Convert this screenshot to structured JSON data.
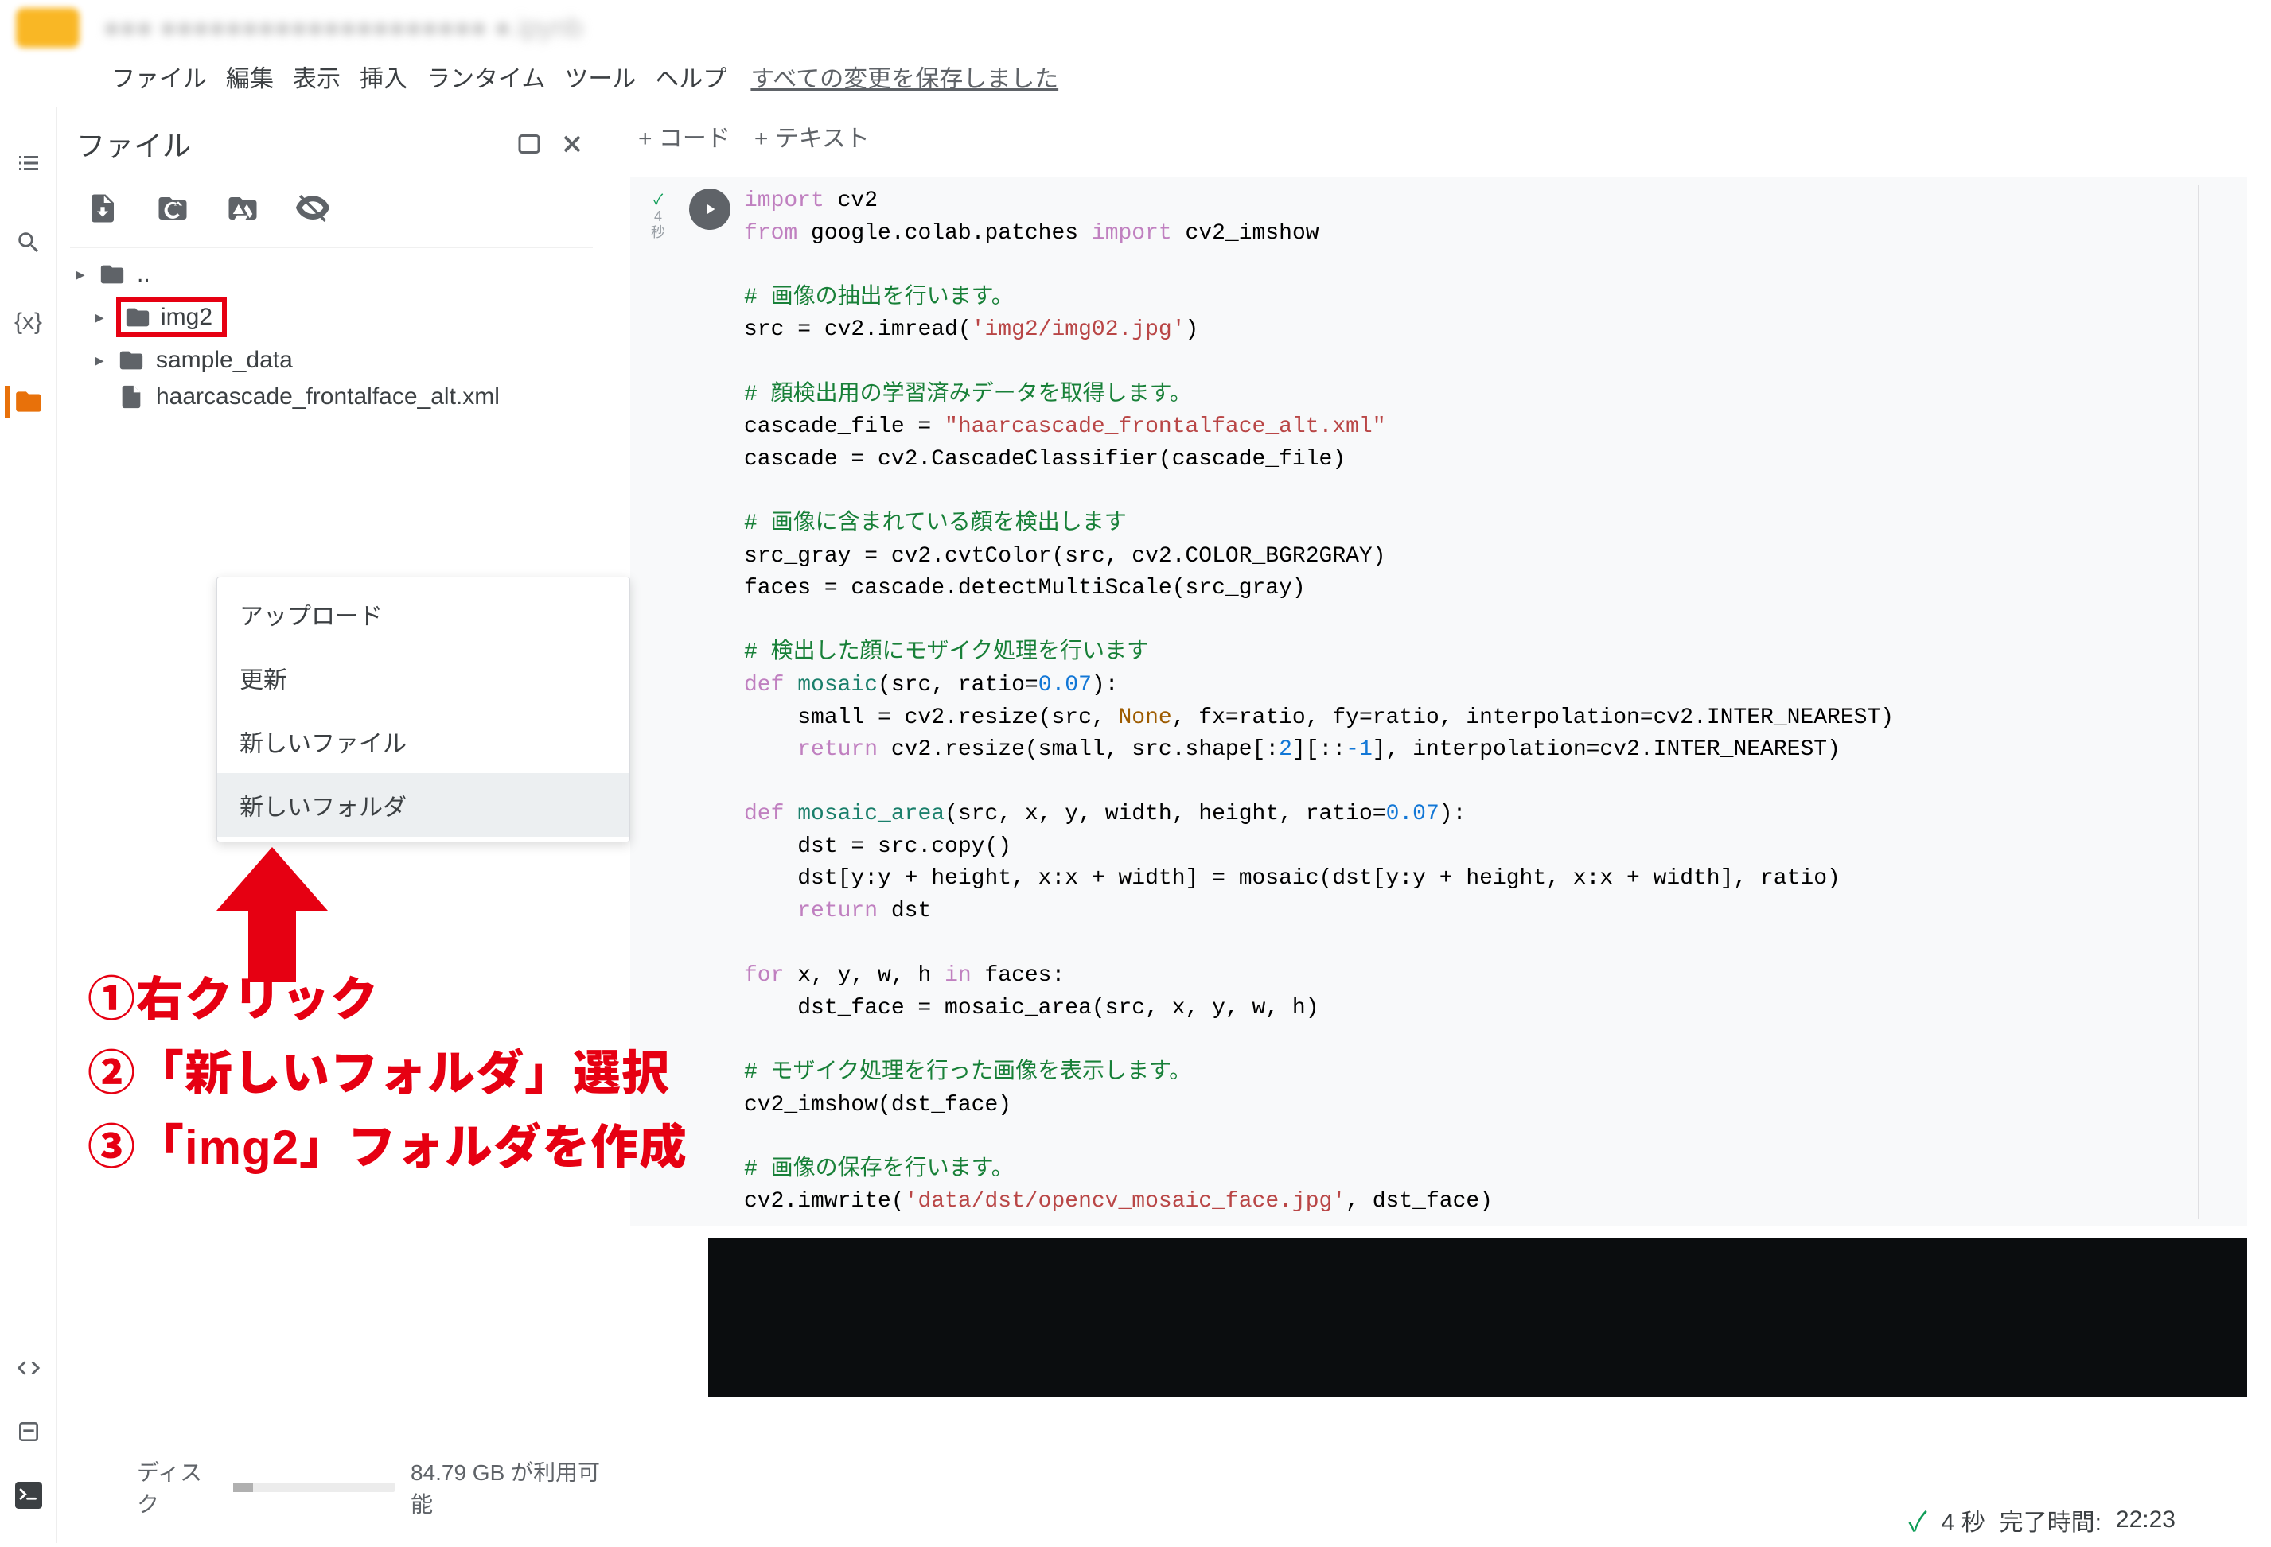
{
  "header": {
    "doc_title": "●●● ●●●●●●●●●●●●●●●●●●●● ●.ipynb"
  },
  "menubar": {
    "file": "ファイル",
    "edit": "編集",
    "view": "表示",
    "insert": "挿入",
    "runtime": "ランタイム",
    "tools": "ツール",
    "help": "ヘルプ",
    "save_status": "すべての変更を保存しました"
  },
  "sidebar": {
    "title": "ファイル",
    "tree": {
      "root_up": "..",
      "img2": "img2",
      "sample_data": "sample_data",
      "xmlfile": "haarcascade_frontalface_alt.xml"
    },
    "context_menu": {
      "upload": "アップロード",
      "refresh": "更新",
      "new_file": "新しいファイル",
      "new_folder": "新しいフォルダ"
    },
    "disk_label": "ディスク",
    "disk_free": "84.79 GB が利用可能"
  },
  "annotations": {
    "line1": "①右クリック",
    "line2": "②「新しいフォルダ」選択",
    "line3": "③「img2」フォルダを作成"
  },
  "insert_row": {
    "code": "+ コード",
    "text": "+ テキスト"
  },
  "cell_status": {
    "check": "✓",
    "secs": "4",
    "unit": "秒"
  },
  "code_lines": {
    "l1a": "import",
    "l1b": " cv2",
    "l2a": "from",
    "l2b": " google.colab.patches ",
    "l2c": "import",
    "l2d": " cv2_imshow",
    "c1": "# 画像の抽出を行います。",
    "l3a": "src = cv2.",
    "l3b": "imread",
    "l3c": "(",
    "l3d": "'img2/img02.jpg'",
    "l3e": ")",
    "c2": "# 顔検出用の学習済みデータを取得します。",
    "l4a": "cascade_file = ",
    "l4b": "\"haarcascade_frontalface_alt.xml\"",
    "l5": "cascade = cv2.CascadeClassifier(cascade_file)",
    "c3": "# 画像に含まれている顔を検出します",
    "l6": "src_gray = cv2.cvtColor(src, cv2.COLOR_BGR2GRAY)",
    "l7": "faces = cascade.detectMultiScale(src_gray)",
    "c4": "# 検出した顔にモザイク処理を行います",
    "l8a": "def",
    "l8b": " mosaic",
    "l8c": "(src, ratio=",
    "l8d": "0.07",
    "l8e": "):",
    "l9a": "    small = cv2.resize(src, ",
    "l9b": "None",
    "l9c": ", fx=ratio, fy=ratio, interpolation=cv2.INTER_NEAREST)",
    "l10a": "    ",
    "l10b": "return",
    "l10c": " cv2.resize(small, src.shape[:",
    "l10d": "2",
    "l10e": "][::",
    "l10f": "-1",
    "l10g": "], interpolation=cv2.INTER_NEAREST)",
    "l11a": "def",
    "l11b": " mosaic_area",
    "l11c": "(src, x, y, width, height, ratio=",
    "l11d": "0.07",
    "l11e": "):",
    "l12": "    dst = src.copy()",
    "l13": "    dst[y:y + height, x:x + width] = mosaic(dst[y:y + height, x:x + width], ratio)",
    "l14a": "    ",
    "l14b": "return",
    "l14c": " dst",
    "l15a": "for",
    "l15b": " x, y, w, h ",
    "l15c": "in",
    "l15d": " faces:",
    "l16": "    dst_face = mosaic_area(src, x, y, w, h)",
    "c5a": "# モザイク処理",
    "c5b": "を行った画像を表示します。",
    "l17": "cv2_imshow(dst_face)",
    "c6": "# 画像の保存を行います。",
    "l18a": "cv2.imwrite(",
    "l18b": "'data/dst/opencv_mosaic_face.jpg'",
    "l18c": ", dst_face)"
  },
  "footer": {
    "check": "✓",
    "secs": "4 秒",
    "done_label": "完了時間:",
    "done_time": "22:23"
  }
}
